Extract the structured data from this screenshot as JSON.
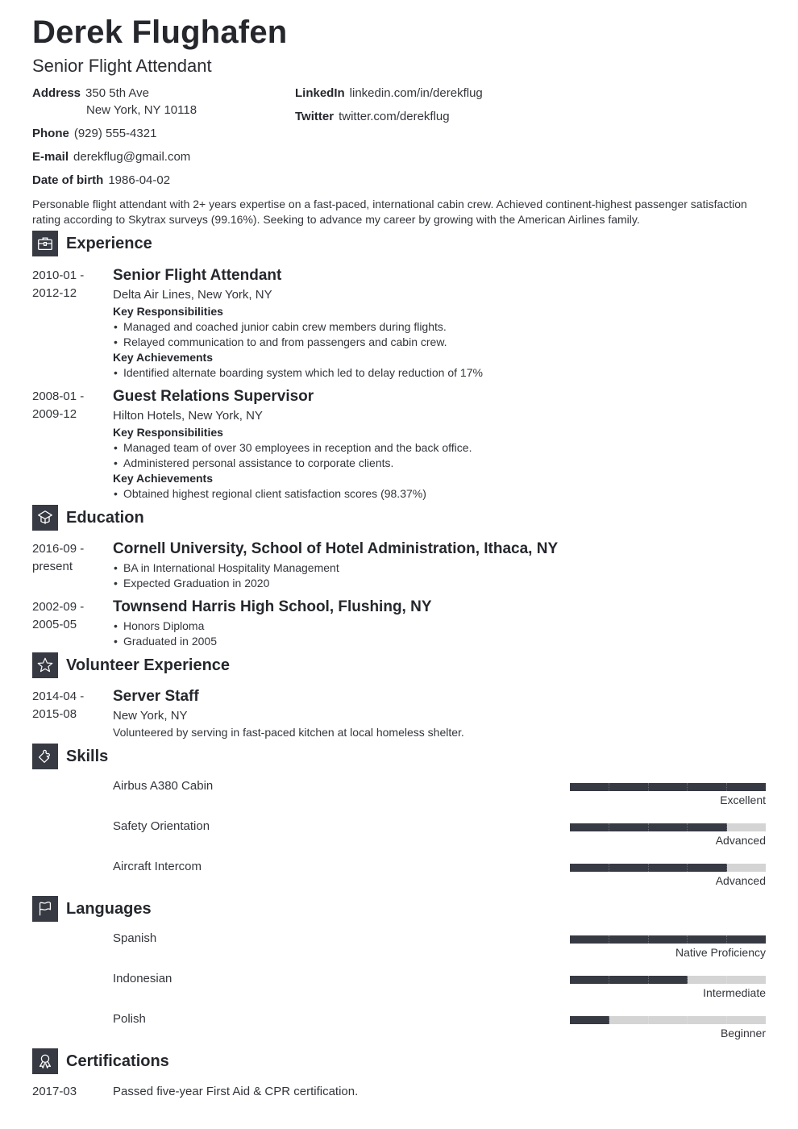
{
  "header": {
    "name": "Derek Flughafen",
    "title": "Senior Flight Attendant"
  },
  "contact": {
    "address_label": "Address",
    "address_line1": "350 5th Ave",
    "address_line2": "New York, NY 10118",
    "phone_label": "Phone",
    "phone": "(929) 555-4321",
    "email_label": "E-mail",
    "email": "derekflug@gmail.com",
    "dob_label": "Date of birth",
    "dob": "1986-04-02",
    "linkedin_label": "LinkedIn",
    "linkedin": "linkedin.com/in/derekflug",
    "twitter_label": "Twitter",
    "twitter": "twitter.com/derekflug"
  },
  "summary": "Personable flight attendant with 2+ years expertise on a fast-paced, international cabin crew. Achieved continent-highest passenger satisfaction rating according to Skytrax surveys (99.16%). Seeking to advance my career by growing with the American Airlines family.",
  "sections": {
    "experience": {
      "title": "Experience",
      "icon": "briefcase-icon"
    },
    "education": {
      "title": "Education",
      "icon": "graduation-cap-icon"
    },
    "volunteer": {
      "title": "Volunteer Experience",
      "icon": "star-icon"
    },
    "skills": {
      "title": "Skills",
      "icon": "puzzle-piece-icon"
    },
    "languages": {
      "title": "Languages",
      "icon": "flag-icon"
    },
    "certifications": {
      "title": "Certifications",
      "icon": "award-ribbon-icon"
    }
  },
  "experience": [
    {
      "date_start": "2010-01 -",
      "date_end": "2012-12",
      "title": "Senior Flight Attendant",
      "company": "Delta Air Lines, New York, NY",
      "resp_heading": "Key Responsibilities",
      "responsibilities": [
        "Managed and coached junior cabin crew members during flights.",
        "Relayed communication to and from passengers and cabin crew."
      ],
      "ach_heading": "Key Achievements",
      "achievements": [
        "Identified alternate boarding system which led to delay reduction of 17%"
      ]
    },
    {
      "date_start": "2008-01 -",
      "date_end": "2009-12",
      "title": "Guest Relations Supervisor",
      "company": "Hilton Hotels, New York, NY",
      "resp_heading": "Key Responsibilities",
      "responsibilities": [
        "Managed team of over 30 employees in reception and the back office.",
        "Administered personal assistance to corporate clients."
      ],
      "ach_heading": "Key Achievements",
      "achievements": [
        "Obtained highest regional client satisfaction scores (98.37%)"
      ]
    }
  ],
  "education": [
    {
      "date_start": "2016-09 -",
      "date_end": "present",
      "title": "Cornell University, School of Hotel Administration, Ithaca, NY",
      "bullets": [
        "BA in International Hospitality Management",
        "Expected Graduation in 2020"
      ]
    },
    {
      "date_start": "2002-09 -",
      "date_end": "2005-05",
      "title": "Townsend Harris High School, Flushing, NY",
      "bullets": [
        "Honors Diploma",
        "Graduated in 2005"
      ]
    }
  ],
  "volunteer": [
    {
      "date_start": "2014-04 -",
      "date_end": "2015-08",
      "title": "Server Staff",
      "location": "New York, NY",
      "description": "Volunteered by serving in fast-paced kitchen at local homeless shelter."
    }
  ],
  "skills": [
    {
      "name": "Airbus A380 Cabin",
      "level": "Excellent",
      "filled": 5,
      "total": 5
    },
    {
      "name": "Safety Orientation",
      "level": "Advanced",
      "filled": 4,
      "total": 5
    },
    {
      "name": "Aircraft Intercom",
      "level": "Advanced",
      "filled": 4,
      "total": 5
    }
  ],
  "languages": [
    {
      "name": "Spanish",
      "level": "Native Proficiency",
      "filled": 5,
      "total": 5
    },
    {
      "name": "Indonesian",
      "level": "Intermediate",
      "filled": 3,
      "total": 5
    },
    {
      "name": "Polish",
      "level": "Beginner",
      "filled": 1,
      "total": 5
    }
  ],
  "certifications": [
    {
      "date": "2017-03",
      "description": "Passed five-year First Aid & CPR certification."
    }
  ],
  "colors": {
    "accent": "#373a43",
    "bar_empty": "#d4d4d4",
    "text": "#2b2d33"
  }
}
